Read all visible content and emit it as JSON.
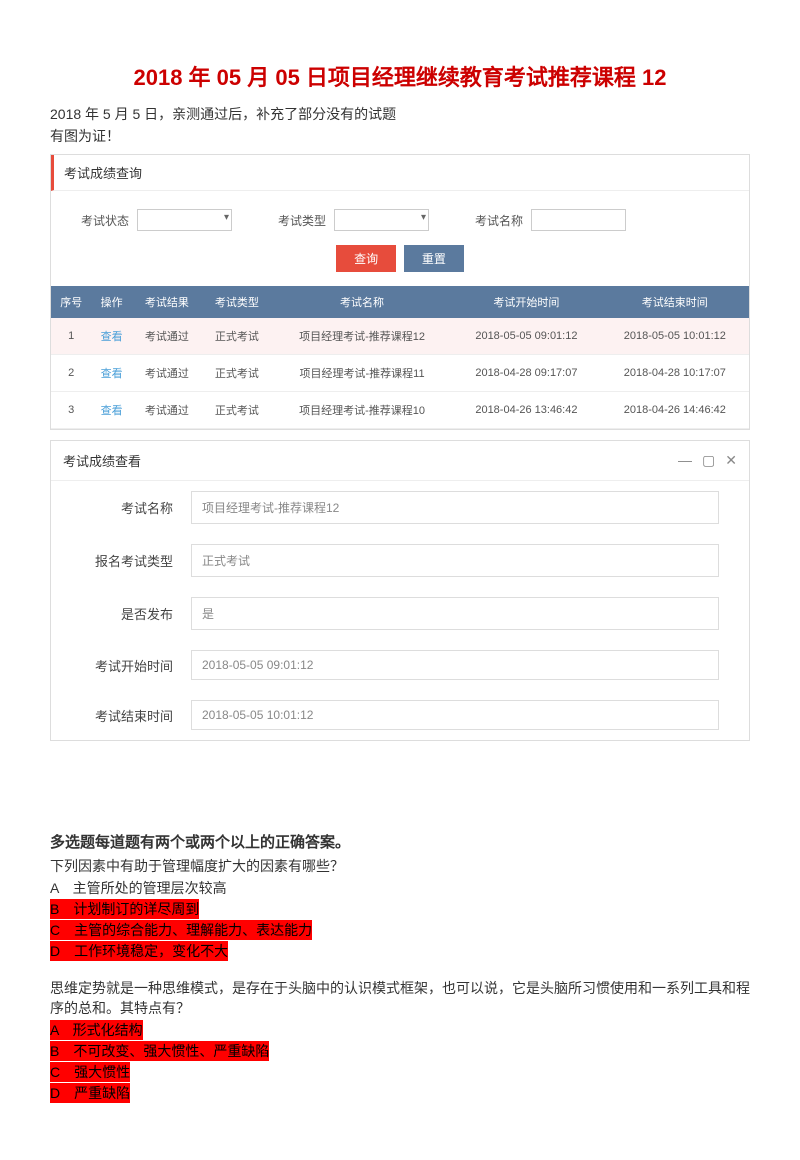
{
  "title": "2018 年 05 月 05 日项目经理继续教育考试推荐课程 12",
  "subtitle": "2018 年 5 月 5 日，亲测通过后，补充了部分没有的试题",
  "evidence": "有图为证！",
  "searchPanel": {
    "header": "考试成绩查询",
    "labels": {
      "status": "考试状态",
      "type": "考试类型",
      "name": "考试名称"
    },
    "buttons": {
      "search": "查询",
      "reset": "重置"
    }
  },
  "table": {
    "headers": [
      "序号",
      "操作",
      "考试结果",
      "考试类型",
      "考试名称",
      "考试开始时间",
      "考试结束时间"
    ],
    "rows": [
      {
        "num": "1",
        "op": "查看",
        "result": "考试通过",
        "type": "正式考试",
        "name": "项目经理考试-推荐课程12",
        "start": "2018-05-05 09:01:12",
        "end": "2018-05-05 10:01:12",
        "highlight": true
      },
      {
        "num": "2",
        "op": "查看",
        "result": "考试通过",
        "type": "正式考试",
        "name": "项目经理考试-推荐课程11",
        "start": "2018-04-28 09:17:07",
        "end": "2018-04-28 10:17:07",
        "highlight": false
      },
      {
        "num": "3",
        "op": "查看",
        "result": "考试通过",
        "type": "正式考试",
        "name": "项目经理考试-推荐课程10",
        "start": "2018-04-26 13:46:42",
        "end": "2018-04-26 14:46:42",
        "highlight": false
      }
    ]
  },
  "detail": {
    "header": "考试成绩查看",
    "fields": [
      {
        "label": "考试名称",
        "value": "项目经理考试-推荐课程12"
      },
      {
        "label": "报名考试类型",
        "value": "正式考试"
      },
      {
        "label": "是否发布",
        "value": "是"
      },
      {
        "label": "考试开始时间",
        "value": "2018-05-05 09:01:12"
      },
      {
        "label": "考试结束时间",
        "value": "2018-05-05 10:01:12"
      }
    ]
  },
  "sectionTitle": "多选题每道题有两个或两个以上的正确答案。",
  "q1": {
    "prompt": "下列因素中有助于管理幅度扩大的因素有哪些？",
    "options": [
      {
        "key": "A",
        "text": "主管所处的管理层次较高",
        "hl": false
      },
      {
        "key": "B",
        "text": "计划制订的详尽周到",
        "hl": true
      },
      {
        "key": "C",
        "text": "主管的综合能力、理解能力、表达能力",
        "hl": true
      },
      {
        "key": "D",
        "text": "工作环境稳定，变化不大",
        "hl": true
      }
    ]
  },
  "q2": {
    "prompt": "思维定势就是一种思维模式，是存在于头脑中的认识模式框架，也可以说，它是头脑所习惯使用和一系列工具和程序的总和。其特点有？",
    "options": [
      {
        "key": "A",
        "text": "形式化结构",
        "hl": true
      },
      {
        "key": "B",
        "text": "不可改变、强大惯性、严重缺陷",
        "hl": true
      },
      {
        "key": "C",
        "text": "强大惯性",
        "hl": true
      },
      {
        "key": "D",
        "text": "严重缺陷",
        "hl": true
      }
    ]
  }
}
